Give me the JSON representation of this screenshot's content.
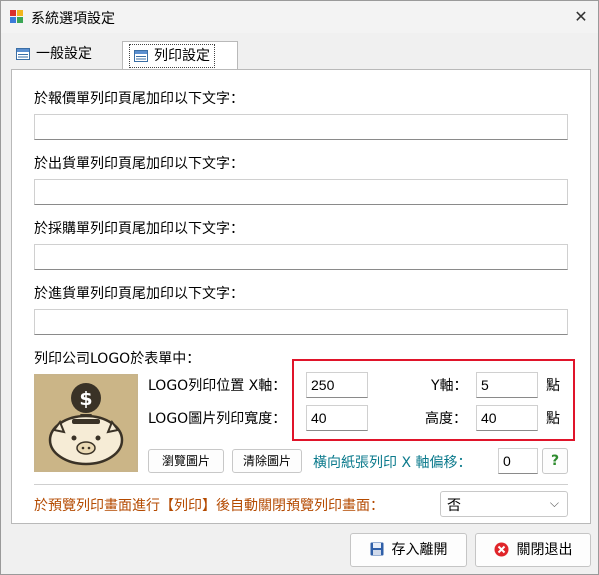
{
  "window": {
    "title": "系統選項設定",
    "close_symbol": "✕"
  },
  "tabs": [
    {
      "label": "一般設定",
      "selected": false
    },
    {
      "label": "列印設定",
      "selected": true
    }
  ],
  "footer_fields": [
    {
      "label": "於報價單列印頁尾加印以下文字：",
      "value": ""
    },
    {
      "label": "於出貨單列印頁尾加印以下文字：",
      "value": ""
    },
    {
      "label": "於採購單列印頁尾加印以下文字：",
      "value": ""
    },
    {
      "label": "於進貨單列印頁尾加印以下文字：",
      "value": ""
    }
  ],
  "logo": {
    "section_label": "列印公司LOGO於表單中：",
    "position_label": "LOGO列印位置 X軸：",
    "x_value": "250",
    "y_label": "Y軸：",
    "y_value": "5",
    "unit1": "點",
    "width_label": "LOGO圖片列印寬度：",
    "width_value": "40",
    "height_label": "高度：",
    "height_value": "40",
    "unit2": "點",
    "browse_button": "瀏覽圖片",
    "clear_button": "清除圖片",
    "offset_label": "橫向紙張列印 X 軸偏移：",
    "offset_value": "0",
    "help_button": "?"
  },
  "auto_close": {
    "label": "於預覽列印畫面進行【列印】後自動關閉預覽列印畫面：",
    "selected": "否"
  },
  "buttons": {
    "save": "存入離開",
    "close": "關閉退出"
  },
  "colors": {
    "highlight_border": "#e0142a",
    "teal_text": "#0b7a8c",
    "orange_text": "#b44a00"
  }
}
